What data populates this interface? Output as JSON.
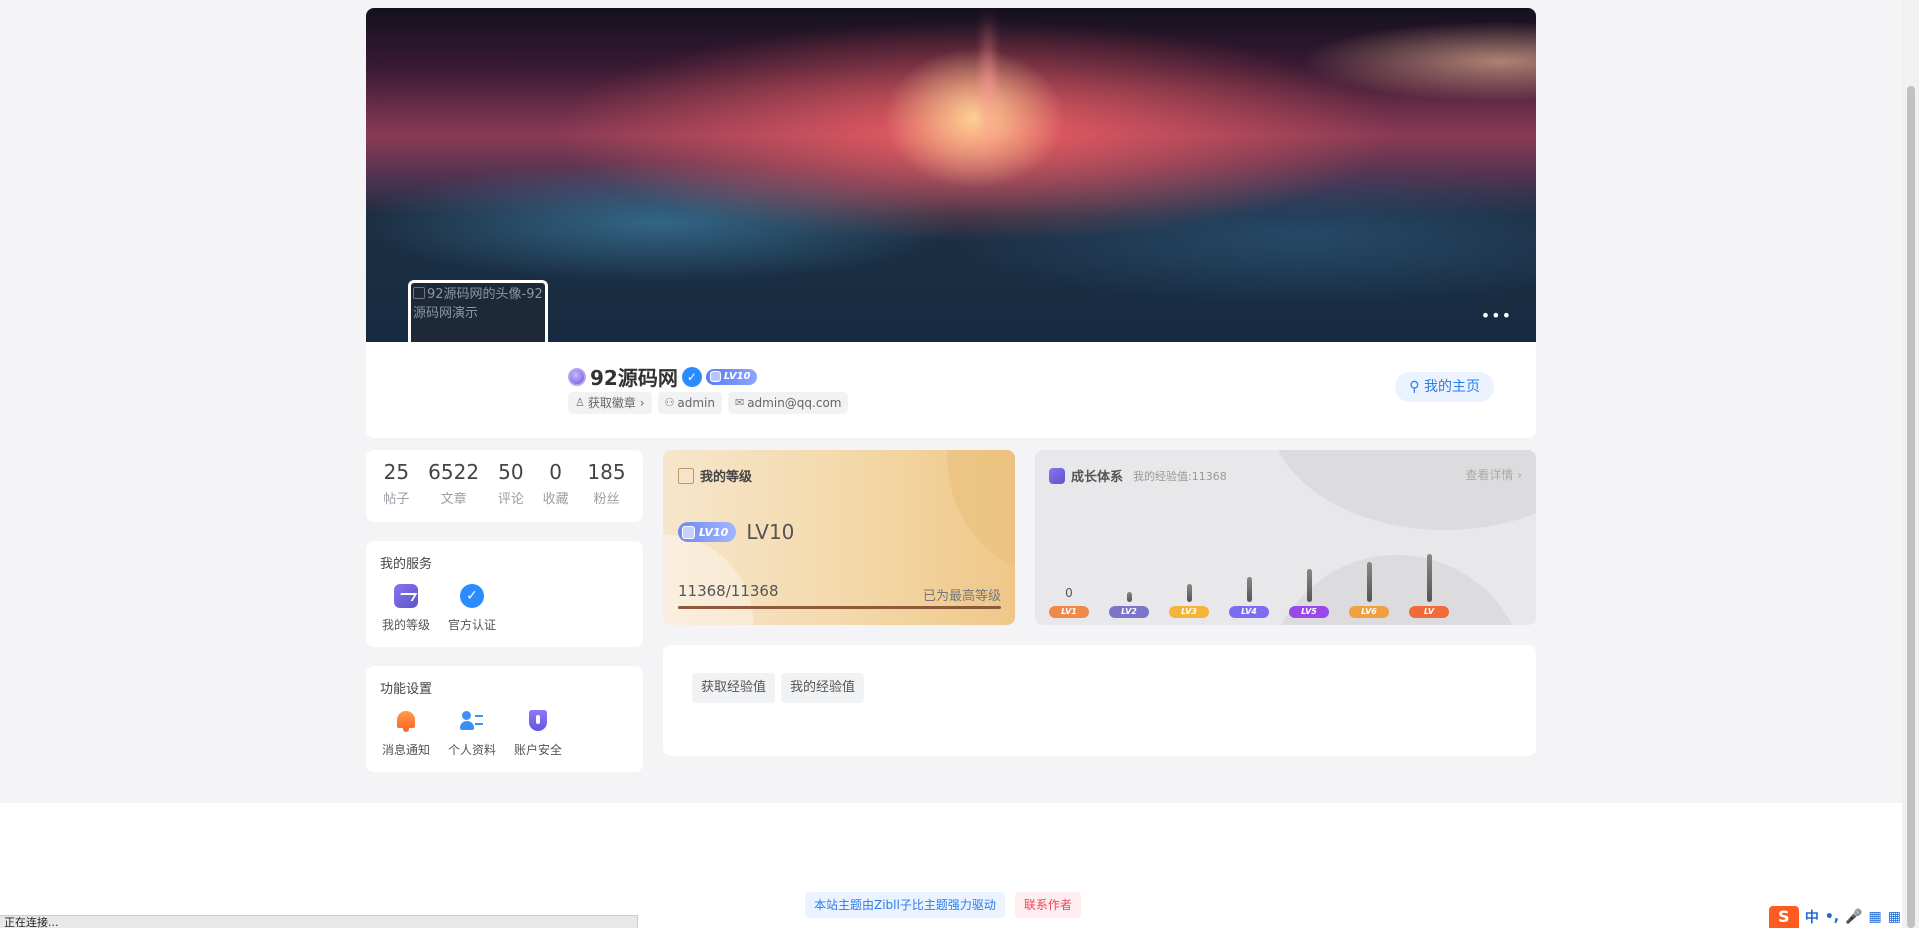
{
  "cover": {
    "more_label": "•••"
  },
  "avatar": {
    "alt_text": "92源码网的头像-92源码网演示"
  },
  "profile": {
    "username": "92源码网",
    "verify_mark": "✓",
    "level_badge": "LV10",
    "chips": [
      {
        "icon": "badge-icon",
        "label": "获取徽章 ›"
      },
      {
        "icon": "user-icon",
        "label": "admin"
      },
      {
        "icon": "mail-icon",
        "label": "admin@qq.com"
      }
    ],
    "homepage_label": "我的主页"
  },
  "stats": [
    {
      "value": "25",
      "label": "帖子"
    },
    {
      "value": "6522",
      "label": "文章"
    },
    {
      "value": "50",
      "label": "评论"
    },
    {
      "value": "0",
      "label": "收藏"
    },
    {
      "value": "185",
      "label": "粉丝"
    }
  ],
  "services": {
    "title": "我的服务",
    "items": [
      {
        "label": "我的等级",
        "icon": "level-chart-icon"
      },
      {
        "label": "官方认证",
        "icon": "verified-icon"
      }
    ]
  },
  "settings": {
    "title": "功能设置",
    "items": [
      {
        "label": "消息通知",
        "icon": "bell-icon"
      },
      {
        "label": "个人资料",
        "icon": "profile-card-icon"
      },
      {
        "label": "账户安全",
        "icon": "shield-icon"
      }
    ]
  },
  "level_card": {
    "title": "我的等级",
    "badge": "LV10",
    "level_text": "LV10",
    "exp_text": "11368/11368",
    "max_text": "已为最高等级",
    "progress": 1.0
  },
  "growth": {
    "title": "成长体系",
    "subtitle": "我的经验值:11368",
    "detail_label": "查看详情 ›",
    "levels": [
      {
        "label": "LV1",
        "value": "0",
        "bar": 0,
        "color": "#f08a4b"
      },
      {
        "label": "LV2",
        "value": "",
        "bar": 0.2,
        "color": "#7b74c9"
      },
      {
        "label": "LV3",
        "value": "",
        "bar": 0.35,
        "color": "#f2b43a"
      },
      {
        "label": "LV4",
        "value": "",
        "bar": 0.5,
        "color": "#7c6df0"
      },
      {
        "label": "LV5",
        "value": "",
        "bar": 0.65,
        "color": "#9b48e8"
      },
      {
        "label": "LV6",
        "value": "",
        "bar": 0.8,
        "color": "#f0a040"
      },
      {
        "label": "LV",
        "value": "",
        "bar": 0.95,
        "color": "#f06a3a"
      }
    ]
  },
  "exp_tabs": {
    "tab1": "获取经验值",
    "tab2": "我的经验值"
  },
  "footer": {
    "powered": "本站主题由Zibll子比主题强力驱动",
    "contact": "联系作者"
  },
  "status_bar": {
    "text": "正在连接..."
  },
  "ime": {
    "logo": "S",
    "items": [
      "中",
      "•,",
      "🎤",
      "▦",
      "▦"
    ]
  }
}
